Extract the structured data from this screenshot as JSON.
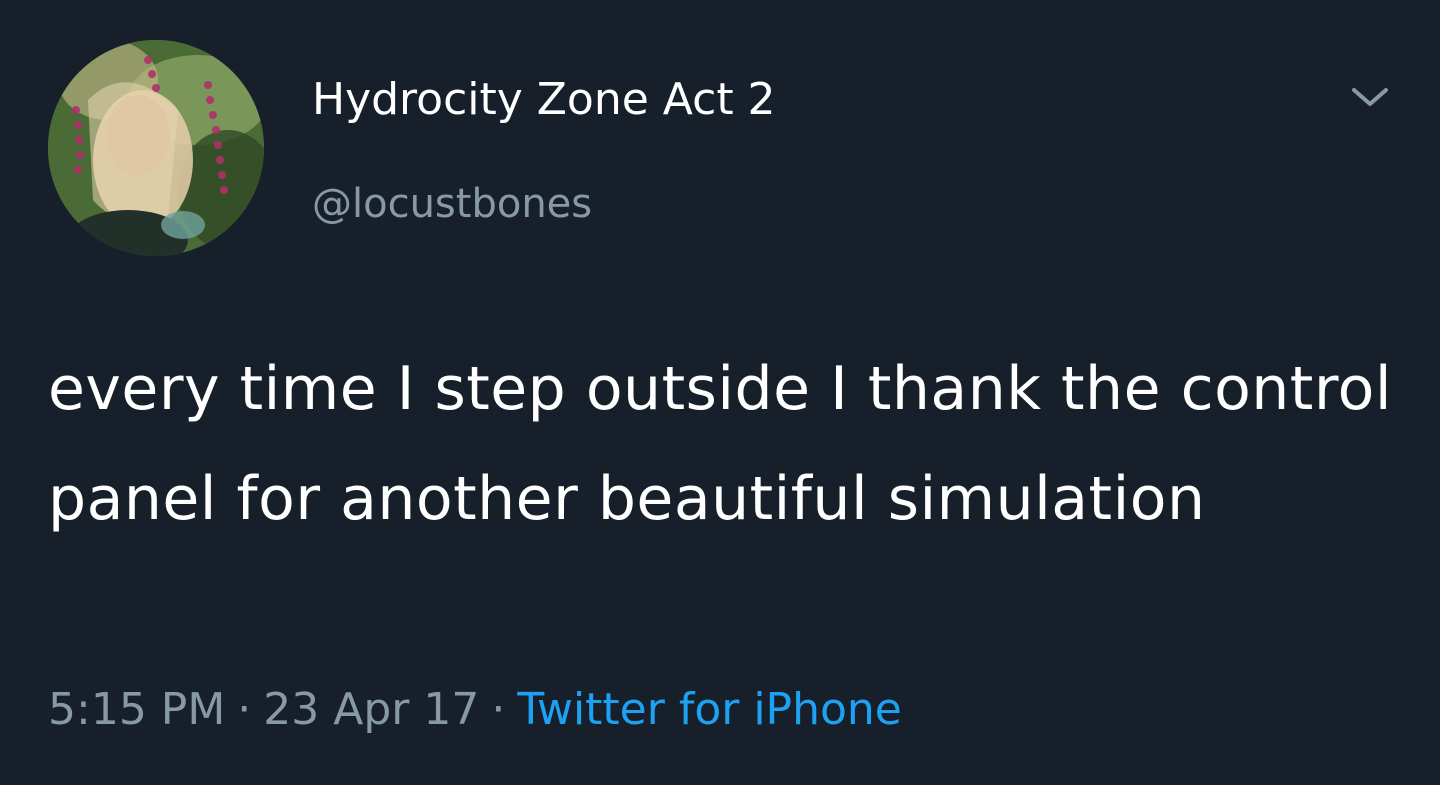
{
  "tweet": {
    "author": {
      "display_name": "Hydrocity Zone Act 2",
      "handle": "@locustbones"
    },
    "text": "every time I step outside I thank the control panel for another beautiful simulation",
    "time": "5:15 PM",
    "separator": "·",
    "date": "23 Apr 17",
    "source": "Twitter for iPhone"
  },
  "icons": {
    "menu": "chevron-down-icon"
  },
  "colors": {
    "background": "#17202a",
    "primary_text": "#ffffff",
    "secondary_text": "#8899a6",
    "link": "#1da1f2"
  }
}
